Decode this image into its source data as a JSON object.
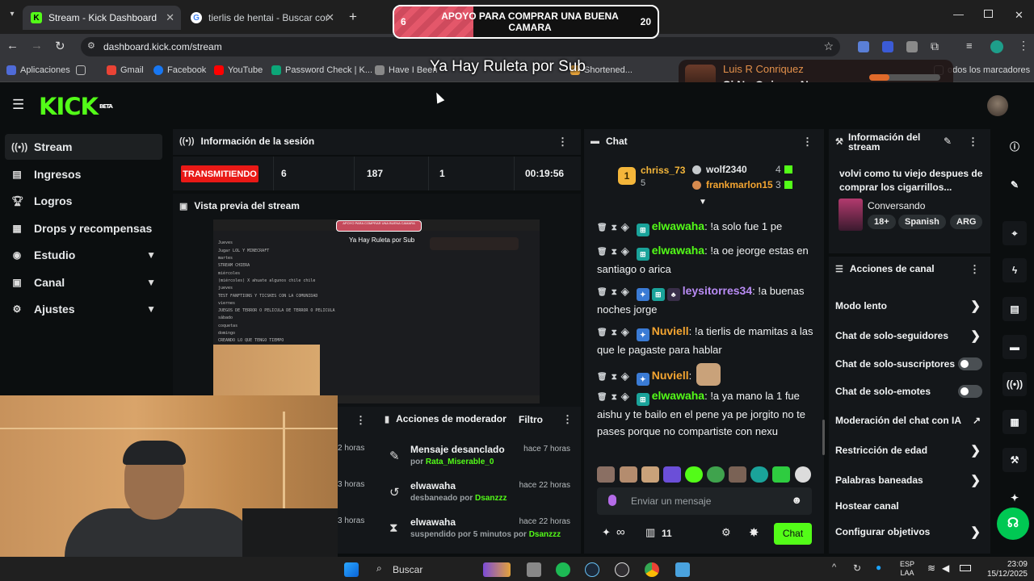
{
  "browser": {
    "tabs": [
      {
        "title": "Stream - Kick Dashboard",
        "active": true
      },
      {
        "title": "tierlis de hentai - Buscar con Go",
        "active": false
      }
    ],
    "url": "dashboard.kick.com/stream",
    "bookmarks": [
      "Aplicaciones",
      "Gmail",
      "Facebook",
      "YouTube",
      "Password Check | K...",
      "Have I Been",
      "Shortened...",
      "odos los marcadores"
    ]
  },
  "overlay": {
    "goal_title": "APOYO PARA COMPRAR UNA BUENA CAMARA",
    "goal_current": "6",
    "goal_target": "20",
    "goal_progress": 0.3,
    "roulette_text": "Ya Hay Ruleta por Sub",
    "alert_name": "Luis R Conriquez",
    "alert_text": "Si No Quieres No"
  },
  "sidebar": {
    "items": [
      {
        "label": "Stream",
        "icon": "signal-icon",
        "active": true
      },
      {
        "label": "Ingresos",
        "icon": "chart-icon"
      },
      {
        "label": "Logros",
        "icon": "trophy-icon"
      },
      {
        "label": "Drops y recompensas",
        "icon": "gift-icon"
      },
      {
        "label": "Estudio",
        "icon": "camera-icon",
        "expandable": true
      },
      {
        "label": "Canal",
        "icon": "user-icon",
        "expandable": true
      },
      {
        "label": "Ajustes",
        "icon": "gear-icon",
        "expandable": true
      }
    ]
  },
  "session": {
    "title": "Información de la sesión",
    "live_label": "TRANSMITIENDO",
    "viewers": "6",
    "followers": "187",
    "subs": "1",
    "duration": "00:19:56"
  },
  "preview": {
    "title": "Vista previa del stream",
    "overlay_goal": "APOYO PARA COMPRAR UNA BUENA CAMARA",
    "overlay_ruleta": "Ya Hay Ruleta por Sub",
    "lines": [
      "Jueves",
      "Jugar LOL Y MINECRAFT",
      "martes",
      "STREAM CHIERA",
      "miércoles",
      "(miércoles) X ahuate algunos chile chile",
      "jueves",
      "TEST FANFTIONS Y TICSKES CON LA COMUNIDAD",
      "viernes",
      "JUEGOS DE TERROR O PELICULA DE TERROR O PELICULA",
      "sábado",
      "coquetas",
      "domingo",
      "CREANDO LO QUE TENGO TIEMPO"
    ]
  },
  "mod_actions": {
    "title": "Acciones de moderador",
    "filter_label": "Filtro",
    "cut_times": [
      "2 horas",
      "3 horas",
      "3 horas"
    ],
    "rows": [
      {
        "icon": "pin-off-icon",
        "user": "Mensaje desanclado",
        "prefix": "por",
        "actor": "Rata_Miserable_0",
        "time": "hace 7 horas"
      },
      {
        "icon": "unban-icon",
        "user": "elwawaha",
        "prefix": "desbaneado por",
        "actor": "Dsanzzz",
        "time": "hace 22 horas"
      },
      {
        "icon": "timeout-icon",
        "user": "elwawaha",
        "prefix": "suspendido por 5 minutos por",
        "actor": "Dsanzzz",
        "time": "hace 22 horas"
      }
    ]
  },
  "chat": {
    "title": "Chat",
    "leaderboard": {
      "rank": "1",
      "first_user": "chriss_73",
      "first_count": "5",
      "second_user": "wolf2340",
      "second_count": "4",
      "third_user": "frankmarlon15",
      "third_count": "3"
    },
    "messages": [
      {
        "user": "elwawaha",
        "color": "#53fc18",
        "text": ": !a solo fue 1 pe"
      },
      {
        "user": "elwawaha",
        "color": "#53fc18",
        "text": ": !a oe jeorge estas en santiago o arica"
      },
      {
        "user": "leysitorres34",
        "color": "#b98cf5",
        "text": ": !a buenas noches jorge"
      },
      {
        "user": "Nuviell",
        "color": "#f4a531",
        "text": ": !a tierlis de mamitas a las que le pagaste para hablar"
      },
      {
        "user": "Nuviell",
        "color": "#f4a531",
        "text": ":"
      },
      {
        "user": "elwawaha",
        "color": "#53fc18",
        "text": ": !a ya mano la 1 fue aishu y te bailo en el pene ya pe jorgito no te pases porque no compartiste con nexu"
      }
    ],
    "input_placeholder": "Enviar un mensaje",
    "viewers_count": "11",
    "infinity": "∞",
    "send_label": "Chat"
  },
  "stream_info": {
    "title": "Información del stream",
    "stream_title": "volvi como tu viejo despues de comprar los cigarrillos...",
    "category": "Conversando",
    "tags": [
      "18+",
      "Spanish",
      "ARG"
    ]
  },
  "channel_actions": {
    "title": "Acciones de canal",
    "items": [
      {
        "label": "Modo lento",
        "type": "arrow"
      },
      {
        "label": "Chat de solo-seguidores",
        "type": "arrow"
      },
      {
        "label": "Chat de solo-suscriptores",
        "type": "toggle"
      },
      {
        "label": "Chat de solo-emotes",
        "type": "toggle"
      },
      {
        "label": "Moderación del chat con IA",
        "type": "external"
      },
      {
        "label": "Restricción de edad",
        "type": "arrow"
      },
      {
        "label": "Palabras baneadas",
        "type": "arrow"
      },
      {
        "label": "Hostear canal",
        "type": "none"
      },
      {
        "label": "Configurar objetivos",
        "type": "arrow"
      }
    ]
  },
  "taskbar": {
    "search_label": "Buscar",
    "lang1": "ESP",
    "lang2": "LAA",
    "time": "23:09",
    "date": "15/12/2025"
  },
  "colors": {
    "kick_green": "#53fc18",
    "live_red": "#e91916",
    "panel": "#14171a",
    "bg": "#0b0e0f"
  }
}
